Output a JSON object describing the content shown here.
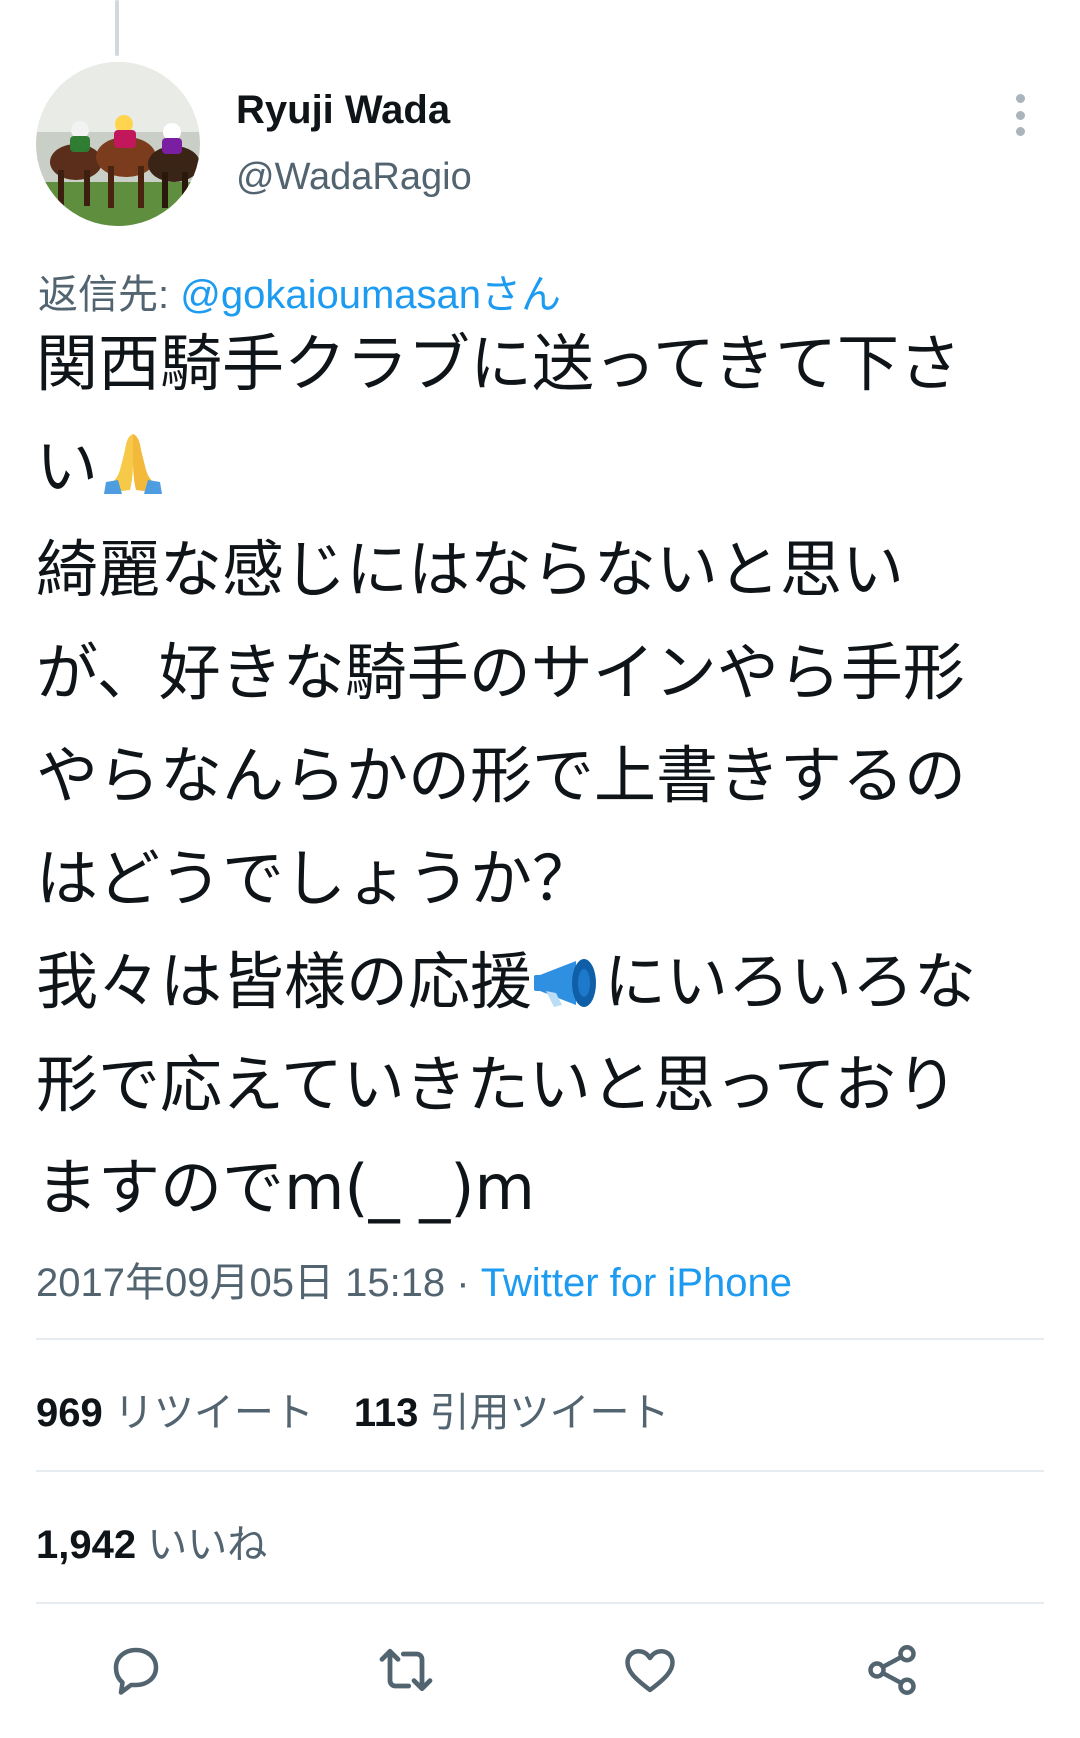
{
  "tweet": {
    "display_name": "Ryuji Wada",
    "handle": "@WadaRagio",
    "reply_prefix": "返信先: ",
    "reply_mention": "@gokaioumasanさん",
    "lines": [
      "関西騎手クラブに送ってきて下さ",
      "い",
      "綺麗な感じにはならないと思い",
      "が、好きな騎手のサインやら手形",
      "やらなんらかの形で上書きするの",
      "はどうでしょうか？",
      "我々は皆様の応援",
      "にいろいろな",
      "形で応えていきたいと思っており",
      "ますのでm(_ _)m"
    ],
    "emojis": [
      "folded-hands",
      "megaphone"
    ],
    "timestamp": "2017年09月05日 15:18",
    "separator": " · ",
    "source": "Twitter for iPhone"
  },
  "stats": {
    "retweets_count": "969",
    "retweets_label": " リツイート",
    "quotes_count": "113",
    "quotes_label": " 引用ツイート",
    "likes_count": "1,942",
    "likes_label": " いいね"
  },
  "actions": [
    "reply-icon",
    "retweet-icon",
    "like-icon",
    "share-icon"
  ],
  "colors": {
    "accent": "#1d9bf0",
    "text": "#0f1419",
    "secondary": "#536471",
    "divider": "#e6ecf0",
    "icon": "#536471"
  }
}
